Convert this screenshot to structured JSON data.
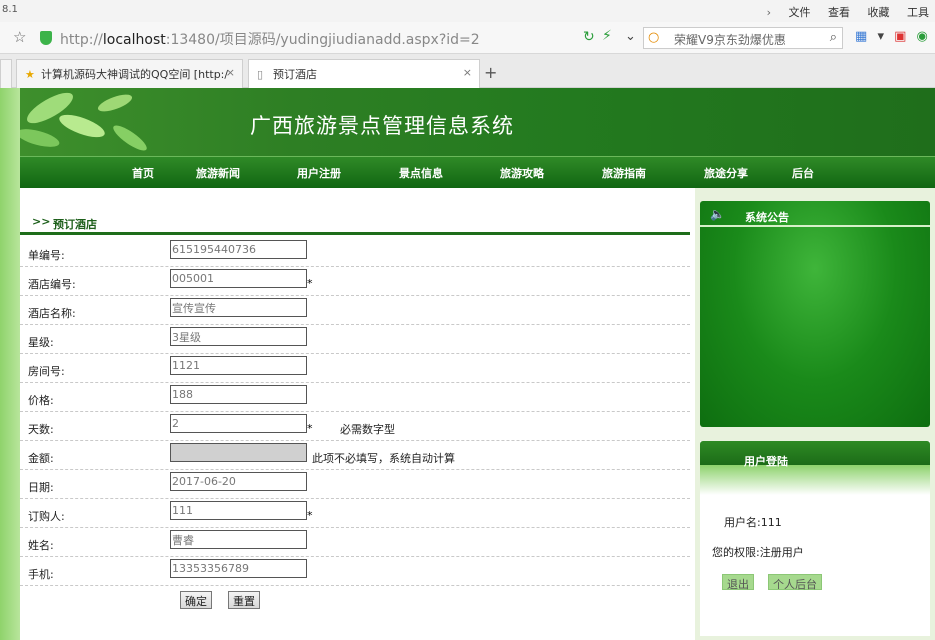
{
  "browser": {
    "version_label": "8.1",
    "menu": [
      "文件",
      "查看",
      "收藏",
      "工具"
    ],
    "url_prefix": "http://",
    "url_host": "localhost",
    "url_rest": ":13480/项目源码/yudingjiudianadd.aspx?id=2",
    "search_text": "荣耀V9京东劲爆优惠",
    "tabs": [
      {
        "label": "计算机源码大神调试的QQ空间 [http:/"
      },
      {
        "label": "预订酒店"
      }
    ],
    "new_tab": "+",
    "close": "×"
  },
  "site": {
    "title": "广西旅游景点管理信息系统",
    "nav": [
      "首页",
      "旅游新闻",
      "用户注册",
      "景点信息",
      "旅游攻略",
      "旅游指南",
      "旅途分享",
      "后台"
    ]
  },
  "form": {
    "section_arrows": ">>",
    "section_title": "预订酒店",
    "required_mark": "*",
    "fields": [
      {
        "label": "单编号:",
        "value": "615195440736"
      },
      {
        "label": "酒店编号:",
        "value": "005001"
      },
      {
        "label": "酒店名称:",
        "value": "宣传宣传"
      },
      {
        "label": "星级:",
        "value": "3星级"
      },
      {
        "label": "房间号:",
        "value": "1121"
      },
      {
        "label": "价格:",
        "value": "188"
      },
      {
        "label": "天数:",
        "value": "2"
      },
      {
        "label": "金额:",
        "value": ""
      },
      {
        "label": "日期:",
        "value": "2017-06-20"
      },
      {
        "label": "订购人:",
        "value": "111"
      },
      {
        "label": "姓名:",
        "value": "曹睿"
      },
      {
        "label": "手机:",
        "value": "13353356789"
      }
    ],
    "days_hint": "必需数字型",
    "amount_hint": "此项不必填写，系统自动计算",
    "confirm_label": "确定",
    "reset_label": "重置"
  },
  "sidebar": {
    "notice_title": "系统公告",
    "login_title": "用户登陆",
    "username_line": "用户名:111",
    "permission_line": "您的权限:注册用户",
    "logout_label": "退出",
    "personal_label": "个人后台"
  }
}
